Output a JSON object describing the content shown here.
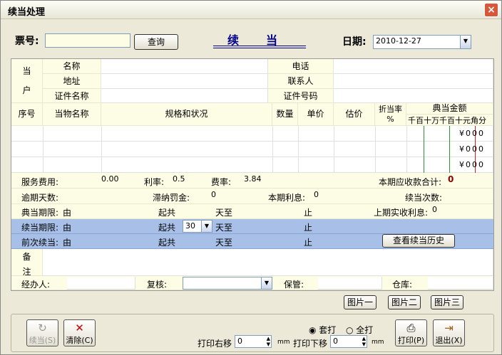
{
  "window": {
    "title": "续当处理",
    "close": "×"
  },
  "top": {
    "ticket_label": "票号:",
    "query_label": "查询",
    "heading": "续　　当",
    "date_label": "日期:",
    "date_value": "2010-12-27"
  },
  "pawner": {
    "side1": "当",
    "side2": "户",
    "name": "名称",
    "address": "地址",
    "id_name": "证件名称",
    "phone": "电话",
    "contact": "联系人",
    "id_no": "证件号码"
  },
  "items": {
    "seq": "序号",
    "goods": "当物名称",
    "spec": "规格和状况",
    "qty": "数量",
    "price": "单价",
    "est": "估价",
    "rate": "折当率",
    "pct": "%",
    "amount": "典当金额",
    "digits": [
      "千",
      "百",
      "十",
      "万",
      "千",
      "百",
      "十",
      "元",
      "角",
      "分"
    ],
    "rows": [
      [
        "¥",
        "0",
        "0",
        "0"
      ],
      [
        "¥",
        "0",
        "0",
        "0"
      ],
      [
        "¥",
        "0",
        "0",
        "0"
      ]
    ]
  },
  "fees": {
    "service": "服务费用:",
    "service_v": "0.00",
    "interest": "利率:",
    "interest_v": "0.5",
    "feerate": "费率:",
    "feerate_v": "3.84",
    "due": "本期应收款合计:",
    "due_v": "0",
    "overdue": "逾期天数:",
    "penalty": "滞纳罚金:",
    "penalty_v": "0",
    "cur_int": "本期利息:",
    "cur_int_v": "0",
    "renew_cnt": "续当次数:",
    "prev_recv": "上期实收利息:",
    "prev_recv_v": "0"
  },
  "periods": {
    "pawn": "典当期限:",
    "renew": "续当期限:",
    "prev": "前次续当:",
    "from": "由",
    "start": "起共",
    "days": "天至",
    "end": "止",
    "renew_days": "30",
    "history": "查看续当历史"
  },
  "notes": {
    "l1": "备",
    "l2": "注"
  },
  "staff": {
    "handler": "经办人:",
    "reviewer": "复核:",
    "keeper": "保管:",
    "store": "仓库:"
  },
  "pics": [
    "图片一",
    "图片二",
    "图片三"
  ],
  "bottom": {
    "renew_btn": "续当(S)",
    "clear_btn": "清除(C)",
    "print_btn": "打印(P)",
    "exit_btn": "退出(X)",
    "tao": "套打",
    "full": "全打",
    "right_shift": "打印右移",
    "right_v": "0",
    "mm1": "mm",
    "down_shift": "打印下移",
    "down_v": "0",
    "mm2": "mm"
  },
  "colors": {
    "blue_row": "#a8c0e8",
    "accent": "#00008b"
  }
}
